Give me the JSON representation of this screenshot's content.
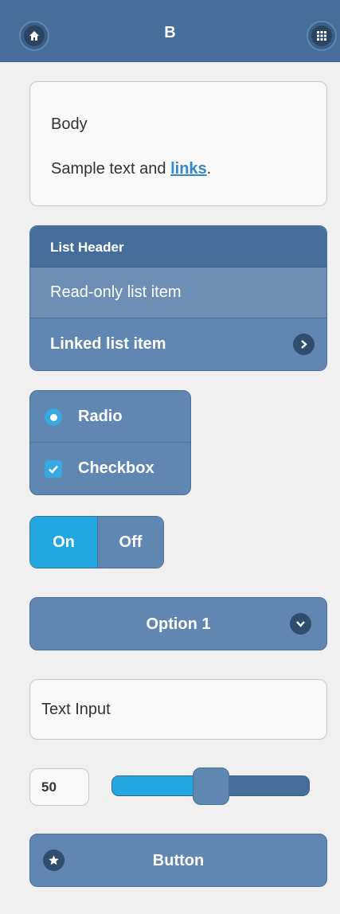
{
  "header": {
    "title": "B",
    "left_icon": "home-icon",
    "right_icon": "grid-icon"
  },
  "body_card": {
    "heading": "Body",
    "sample_prefix": "Sample text and ",
    "link_text": "links",
    "sample_suffix": "."
  },
  "listview": {
    "header": "List Header",
    "read_only_item": "Read-only list item",
    "linked_item": "Linked list item",
    "linked_icon": "chevron-right-icon"
  },
  "controlgroup": {
    "radio_label": "Radio",
    "radio_checked": true,
    "checkbox_label": "Checkbox",
    "checkbox_checked": true
  },
  "flip_switch": {
    "on_label": "On",
    "off_label": "Off",
    "state": "on"
  },
  "select": {
    "selected": "Option 1",
    "icon": "chevron-down-icon"
  },
  "text_input": {
    "placeholder": "Text Input"
  },
  "slider": {
    "value": "50",
    "min": 0,
    "max": 100,
    "level": 0.5
  },
  "button": {
    "label": "Button",
    "icon": "star-icon"
  },
  "colors": {
    "header": "#456f9a",
    "accent": "#22a7e0",
    "control": "#5f87b2",
    "background": "#f0f0f0"
  }
}
